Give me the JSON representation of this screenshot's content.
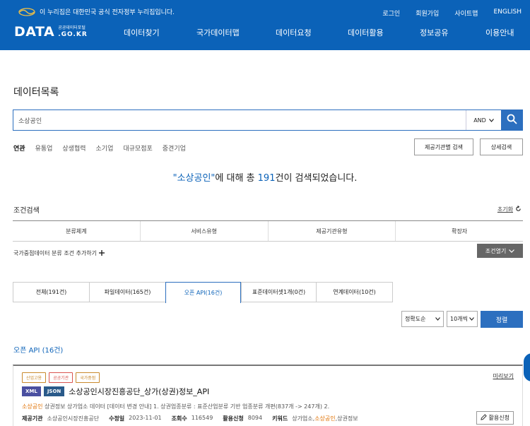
{
  "gov_banner": "이 누리집은 대한민국 공식 전자정부 누리집입니다.",
  "util": [
    "로그인",
    "회원가입",
    "사이트맵",
    "ENGLISH"
  ],
  "logo": {
    "main": "DATA",
    "sub_top": "공공데이터포털",
    "sub_domain": ".GO.KR"
  },
  "gnb": [
    "데이터찾기",
    "국가데이터맵",
    "데이터요청",
    "데이터활용",
    "정보공유",
    "이용안내"
  ],
  "page_title": "데이터목록",
  "search": {
    "value": "소상공인",
    "operator": "AND"
  },
  "related_label": "연관",
  "keywords": [
    "유통업",
    "상생협력",
    "소기업",
    "대규모점포",
    "중견기업"
  ],
  "buttons": {
    "provider_search": "제공기관별 검색",
    "detail_search": "상세검색"
  },
  "result": {
    "kw": "\"소상공인\"",
    "mid": "에 대해 총 ",
    "count": "191",
    "tail": "건이 검색되었습니다."
  },
  "cond": {
    "title": "조건검색",
    "reset": "초기화",
    "cols": [
      "분류체계",
      "서비스유형",
      "제공기관유형",
      "확장자"
    ],
    "add": "국가중점데이터 분류 조건 추가하기",
    "open": "조건열기"
  },
  "tabs": [
    {
      "label": "전체(191건)"
    },
    {
      "label": "파일데이터(165건)"
    },
    {
      "label": "오픈 API(16건)"
    },
    {
      "label": "표준데이터셋1개(0건)"
    },
    {
      "label": "연계데이터(10건)"
    }
  ],
  "sort": {
    "order": "정확도순",
    "per_page": "10개씩",
    "button": "정렬"
  },
  "section": "오픈 API (16건)",
  "card": {
    "badges": [
      "산업고용",
      "공공기관",
      "국가중점"
    ],
    "badge_colors": [
      "#c98a2d",
      "#d9544f",
      "#c98a2d"
    ],
    "preview": "미리보기",
    "formats": [
      "XML",
      "JSON"
    ],
    "title": "소상공인시장진흥공단_상가(상권)정보_API",
    "desc_hl": "소상공인",
    "desc": " 상권정보 상가업소 데이터 [데이터 변경 안내] 1. 상권업종분류 : 표준산업분류 기반 업종분류 개편(837개 -> 247개) 2.",
    "meta": {
      "provider_label": "제공기관",
      "provider": "소상공인시장진흥공단",
      "modified_label": "수정일",
      "modified": "2023-11-01",
      "views_label": "조회수",
      "views": "116549",
      "apply_label": "활용신청",
      "apply": "8094",
      "kw_label": "키워드",
      "kw_pre": "상가업소,",
      "kw_hl": "소상공인",
      "kw_post": ",상권정보"
    },
    "apply_btn": "활용신청"
  }
}
